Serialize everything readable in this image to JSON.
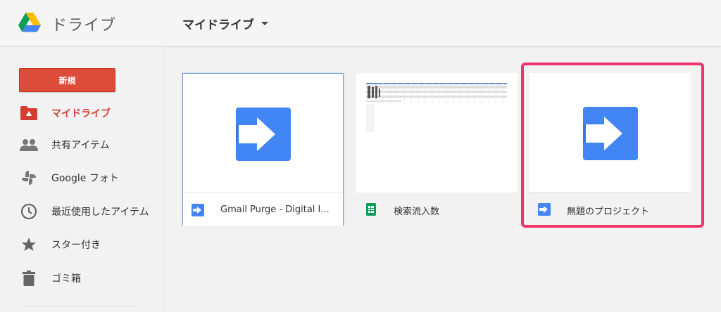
{
  "header": {
    "app_title": "ドライブ",
    "location": "マイドライブ"
  },
  "sidebar": {
    "new_button": "新規",
    "items": [
      {
        "label": "マイドライブ",
        "icon": "my-drive-icon",
        "active": true
      },
      {
        "label": "共有アイテム",
        "icon": "shared-people-icon"
      },
      {
        "label": "Google フォト",
        "icon": "google-photos-icon"
      },
      {
        "label": "最近使用したアイテム",
        "icon": "clock-icon"
      },
      {
        "label": "スター付き",
        "icon": "star-icon"
      },
      {
        "label": "ゴミ箱",
        "icon": "trash-icon"
      }
    ]
  },
  "files": [
    {
      "name": "Gmail Purge - Digital I...",
      "type": "apps-script",
      "icon": "apps-script-icon"
    },
    {
      "name": "検索流入数",
      "type": "spreadsheet",
      "icon": "sheets-icon"
    },
    {
      "name": "無題のプロジェクト",
      "type": "apps-script",
      "icon": "apps-script-icon",
      "highlighted": true
    }
  ],
  "colors": {
    "accent_red": "#dd4b39",
    "script_blue": "#4285f4",
    "sheets_green": "#0f9d58",
    "highlight_pink": "#f0346a"
  }
}
